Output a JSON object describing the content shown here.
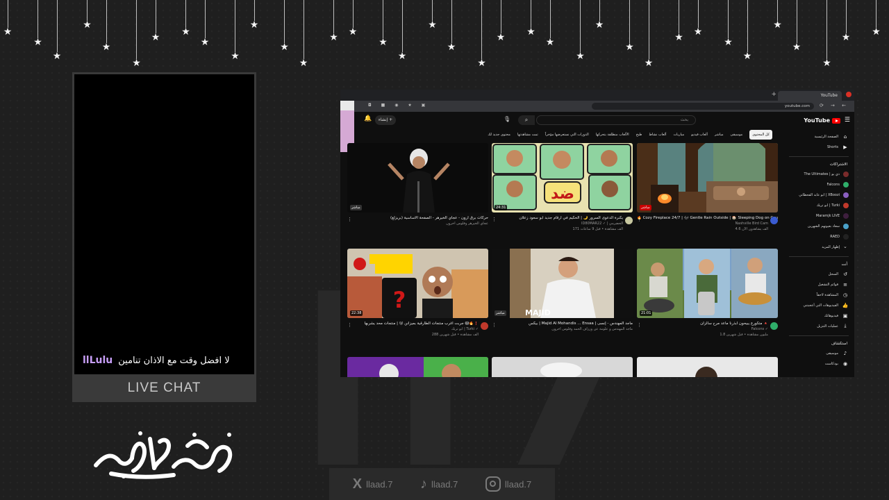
{
  "chat": {
    "username": "llLulu",
    "message": "لا افضل وقت مع الاذان تنامين",
    "label": "LIVE CHAT"
  },
  "browser": {
    "tab_title": "YouTube",
    "url": "youtube.com",
    "logo": "YouTube",
    "search_placeholder": "بحث",
    "create_label": "إنشاء",
    "chips": [
      "كل المحتوى",
      "موسيقى",
      "مباشر",
      "ألعاب فيديو",
      "مباريات",
      "ألعاب نشاط",
      "طبخ",
      "الألعاب منطلقة بتحركها",
      "الدورات التي نستعرضها مؤخراً",
      "تمت مشاهدتها",
      "محتوى جديد لك"
    ],
    "sidebar": {
      "items": [
        {
          "icon": "home-icon",
          "label": "الصفحة الرئيسية"
        },
        {
          "icon": "shorts-icon",
          "label": "Shorts"
        }
      ],
      "subs_header": "الاشتراكات",
      "subs": [
        {
          "label": "The Ultimates | ذي يو",
          "color": "#7a2b2b"
        },
        {
          "label": "Falcons",
          "color": "#2fae6a"
        },
        {
          "label": "ابو عابد القحطاني | XBoozi",
          "color": "#8a5fc0"
        },
        {
          "label": "ابو تريك | Turki",
          "color": "#c0392b"
        },
        {
          "label": "Maramjk LIVE",
          "color": "#3e1f3e"
        },
        {
          "label": "سعاد بعيونهم الشهرين",
          "color": "#49a0c8"
        },
        {
          "label": "RAED",
          "color": "#222222"
        },
        {
          "label": "إظهار المزيد",
          "color": ""
        }
      ],
      "you_header": "أنت",
      "you_items": [
        {
          "icon": "history-icon",
          "label": "السجل"
        },
        {
          "icon": "playlist-icon",
          "label": "قوائم التشغيل"
        },
        {
          "icon": "watch-later-icon",
          "label": "المشاهدة لاحقاً"
        },
        {
          "icon": "liked-icon",
          "label": "الفيديوهات التي أعجبتني"
        },
        {
          "icon": "your-videos-icon",
          "label": "فيديوهاتك"
        },
        {
          "icon": "downloads-icon",
          "label": "عمليات التنزيل"
        }
      ],
      "explore_header": "استكشاف",
      "explore_items": [
        {
          "icon": "music-icon",
          "label": "موسيقى"
        },
        {
          "icon": "podcast-icon",
          "label": "بودكاست"
        }
      ]
    },
    "videos": [
      {
        "title": "🔥 Cozy Fireplace 24/7 | 🌧 Gentle Rain Outside | 🏠 Sleeping Dog on Couch",
        "channel": "Nashville Bird Cam",
        "meta": "4.6 ألف يشاهدون الآن",
        "duration": "مباشر",
        "avatar": "#3a5bd0"
      },
      {
        "title": "يكنرة الدعوى السرور 🌙 | الحكيم في أرقام جديد ابو سعود زعلان",
        "channel": "ID80MAR22 ✓ | الحضرمي",
        "meta": "171 ألف مشاهدة • قبل 9 ساعات",
        "duration": "24:31",
        "avatar": "#c8c8a0"
      },
      {
        "title": "حركات برق ارون - عجاي الخيرهر - الصفحة الأساسية (بريزلغ)",
        "channel": "عجاي الخيرهر وفلوس آخرون",
        "meta": "",
        "duration": "مباشر",
        "avatar": ""
      },
      {
        "title": "متكورع يبيحون أبذرنا ماعد مرح سالزان 🔺",
        "channel": "Falcons ✓",
        "meta": "1.8 مليون مشاهدة • قبل شهرين",
        "duration": "21:01",
        "avatar": "#2fae6a"
      },
      {
        "title": "بيكس | Majid Al Mohandis ... Ensaa | ماجد المهندس - إنسى",
        "channel": "ماجد المهندس و علومة عن ورزاف الحمد وفلوس آخرون",
        "meta": "",
        "duration": "مباشر",
        "avatar": ""
      },
      {
        "title": "جربت اغرب منتجات الطارقية بميزانن 😮 | منتجات محد يشربها 😱🔥❗",
        "channel": "ابو تريك | Turki ✓",
        "meta": "288 ألف مشاهدة • قبل شهرين",
        "duration": "22:38",
        "avatar": "#c0392b"
      }
    ]
  },
  "social": [
    {
      "icon": "x-logo-icon",
      "glyph": "X",
      "handle": "llaad.7"
    },
    {
      "icon": "tiktok-logo-icon",
      "glyph": "♪",
      "handle": "llaad.7"
    },
    {
      "icon": "instagram-logo-icon",
      "glyph": "",
      "handle": "llaad.7"
    }
  ],
  "calligraphy_text": "رمضان مبارك"
}
